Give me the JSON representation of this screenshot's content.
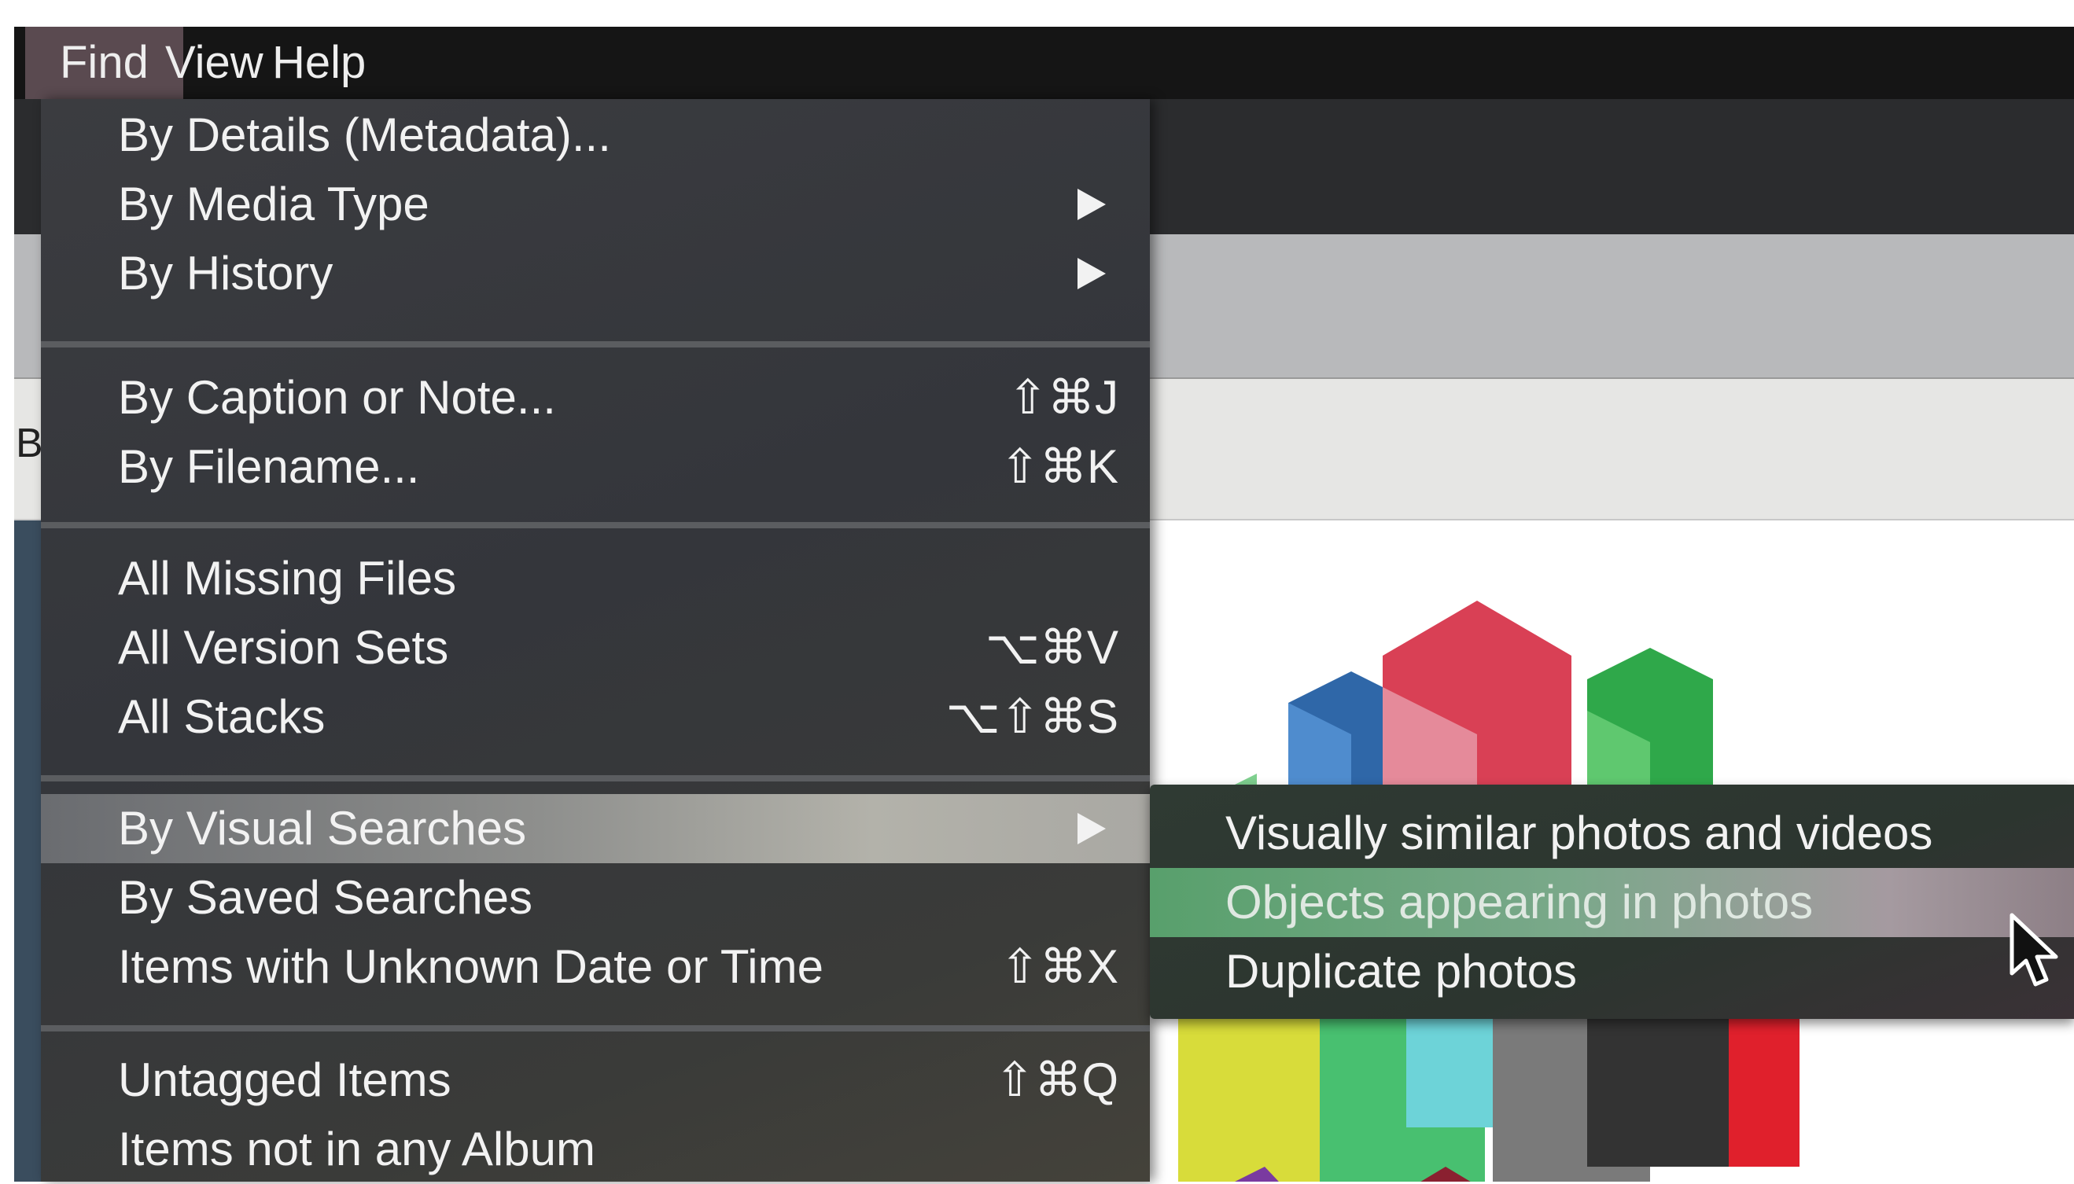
{
  "menubar": {
    "items": [
      {
        "label": "Find",
        "active": true
      },
      {
        "label": "View",
        "active": false
      },
      {
        "label": "Help",
        "active": false
      }
    ]
  },
  "background": {
    "partial_label": "B"
  },
  "find_menu": {
    "items": [
      {
        "label": "By Details (Metadata)...",
        "shortcut": "",
        "submenu": false
      },
      {
        "label": "By Media Type",
        "shortcut": "",
        "submenu": true
      },
      {
        "label": "By History",
        "shortcut": "",
        "submenu": true
      },
      {
        "label": "By Caption or Note...",
        "shortcut": "⇧⌘J",
        "submenu": false
      },
      {
        "label": "By Filename...",
        "shortcut": "⇧⌘K",
        "submenu": false
      },
      {
        "label": "All Missing Files",
        "shortcut": "",
        "submenu": false
      },
      {
        "label": "All Version Sets",
        "shortcut": "⌥⌘V",
        "submenu": false
      },
      {
        "label": "All Stacks",
        "shortcut": "⌥⇧⌘S",
        "submenu": false
      },
      {
        "label": "By Visual Searches",
        "shortcut": "",
        "submenu": true,
        "highlighted": true
      },
      {
        "label": "By Saved Searches",
        "shortcut": "",
        "submenu": false
      },
      {
        "label": "Items with Unknown Date or Time",
        "shortcut": "⇧⌘X",
        "submenu": false
      },
      {
        "label": "Untagged Items",
        "shortcut": "⇧⌘Q",
        "submenu": false
      },
      {
        "label": "Items not in any Album",
        "shortcut": "",
        "submenu": false
      }
    ]
  },
  "visual_submenu": {
    "items": [
      {
        "label": "Visually similar photos and videos",
        "highlighted": false
      },
      {
        "label": "Objects appearing in photos",
        "highlighted": true
      },
      {
        "label": "Duplicate photos",
        "highlighted": false
      }
    ]
  },
  "icons": {
    "submenu_arrow": "triangle-right-icon",
    "cursor": "mouse-pointer-icon"
  },
  "colors": {
    "menu_bg": "#36383c",
    "highlight_menu": "#9a9a95",
    "highlight_submenu": "#6fa681",
    "menubar_active": "#5a4a50"
  }
}
